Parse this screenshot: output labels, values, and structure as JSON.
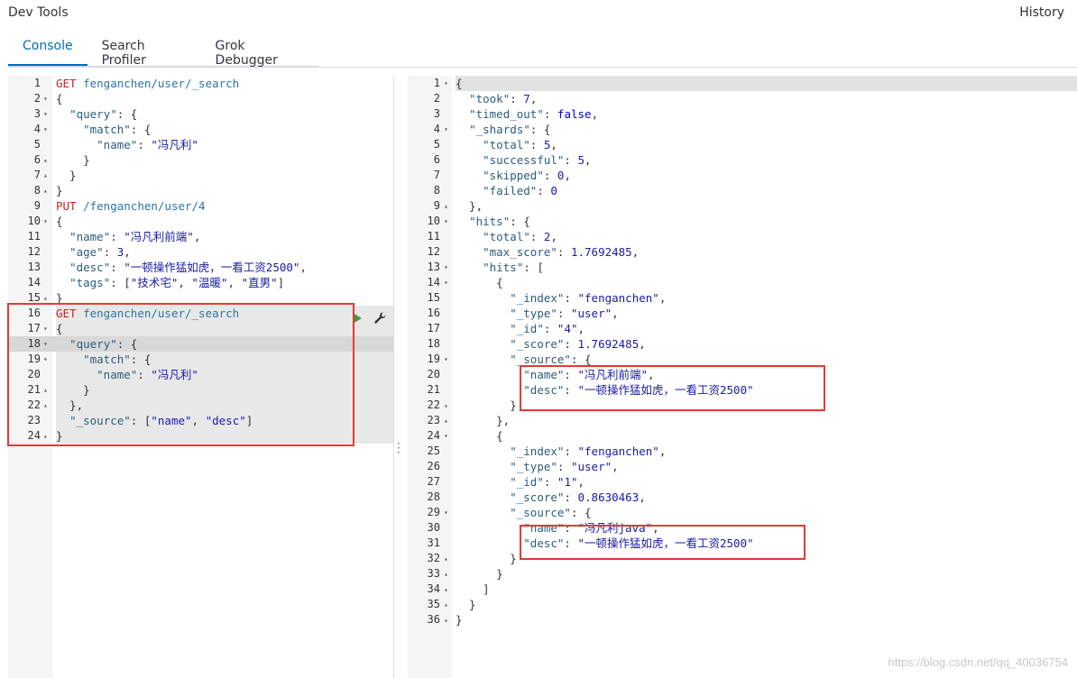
{
  "app": {
    "title": "Dev Tools",
    "history": "History"
  },
  "tabs": [
    {
      "label": "Console"
    },
    {
      "label": "Search Profiler"
    },
    {
      "label": "Grok Debugger"
    }
  ],
  "left_lines": [
    {
      "n": "1",
      "f": "",
      "html": "<span class='m'>GET</span> <span class='u'>fenganchen/user/_search</span>"
    },
    {
      "n": "2",
      "f": "▾",
      "html": "{"
    },
    {
      "n": "3",
      "f": "▾",
      "html": "  <span class='k'>\"query\"</span>: {"
    },
    {
      "n": "4",
      "f": "▾",
      "html": "    <span class='k'>\"match\"</span>: {"
    },
    {
      "n": "5",
      "f": "",
      "html": "      <span class='k'>\"name\"</span>: <span class='s'>\"冯凡利\"</span>"
    },
    {
      "n": "6",
      "f": "▴",
      "html": "    }"
    },
    {
      "n": "7",
      "f": "▴",
      "html": "  }"
    },
    {
      "n": "8",
      "f": "▴",
      "html": "}"
    },
    {
      "n": "9",
      "f": "",
      "html": "<span class='m'>PUT</span> <span class='u'>/fenganchen/user/4</span>"
    },
    {
      "n": "10",
      "f": "▾",
      "html": "{"
    },
    {
      "n": "11",
      "f": "",
      "html": "  <span class='k'>\"name\"</span>: <span class='s'>\"冯凡利前端\"</span>,"
    },
    {
      "n": "12",
      "f": "",
      "html": "  <span class='k'>\"age\"</span>: <span class='n'>3</span>,"
    },
    {
      "n": "13",
      "f": "",
      "html": "  <span class='k'>\"desc\"</span>: <span class='s'>\"一顿操作猛如虎，一看工资2500\"</span>,"
    },
    {
      "n": "14",
      "f": "",
      "html": "  <span class='k'>\"tags\"</span>: [<span class='s'>\"技术宅\"</span>, <span class='s'>\"温暖\"</span>, <span class='s'>\"直男\"</span>]"
    },
    {
      "n": "15",
      "f": "▴",
      "html": "}"
    },
    {
      "n": "16",
      "f": "",
      "html": "<span class='m'>GET</span> <span class='u'>fenganchen/user/_search</span>"
    },
    {
      "n": "17",
      "f": "▾",
      "html": "{"
    },
    {
      "n": "18",
      "f": "▾",
      "html": "  <span class='k'>\"query\"</span>: {"
    },
    {
      "n": "19",
      "f": "▾",
      "html": "    <span class='k'>\"match\"</span>: {"
    },
    {
      "n": "20",
      "f": "",
      "html": "      <span class='k'>\"name\"</span>: <span class='s'>\"冯凡利\"</span>"
    },
    {
      "n": "21",
      "f": "▴",
      "html": "    }"
    },
    {
      "n": "22",
      "f": "▴",
      "html": "  },"
    },
    {
      "n": "23",
      "f": "",
      "html": "  <span class='k'>\"_source\"</span>: [<span class='s'>\"name\"</span>, <span class='s'>\"desc\"</span>]"
    },
    {
      "n": "24",
      "f": "▴",
      "html": "}"
    }
  ],
  "right_lines": [
    {
      "n": "1",
      "f": "▾",
      "html": "{"
    },
    {
      "n": "2",
      "f": "",
      "html": "  <span class='k'>\"took\"</span>: <span class='n'>7</span>,"
    },
    {
      "n": "3",
      "f": "",
      "html": "  <span class='k'>\"timed_out\"</span>: <span class='kw'>false</span>,"
    },
    {
      "n": "4",
      "f": "▾",
      "html": "  <span class='k'>\"_shards\"</span>: {"
    },
    {
      "n": "5",
      "f": "",
      "html": "    <span class='k'>\"total\"</span>: <span class='n'>5</span>,"
    },
    {
      "n": "6",
      "f": "",
      "html": "    <span class='k'>\"successful\"</span>: <span class='n'>5</span>,"
    },
    {
      "n": "7",
      "f": "",
      "html": "    <span class='k'>\"skipped\"</span>: <span class='n'>0</span>,"
    },
    {
      "n": "8",
      "f": "",
      "html": "    <span class='k'>\"failed\"</span>: <span class='n'>0</span>"
    },
    {
      "n": "9",
      "f": "▴",
      "html": "  },"
    },
    {
      "n": "10",
      "f": "▾",
      "html": "  <span class='k'>\"hits\"</span>: {"
    },
    {
      "n": "11",
      "f": "",
      "html": "    <span class='k'>\"total\"</span>: <span class='n'>2</span>,"
    },
    {
      "n": "12",
      "f": "",
      "html": "    <span class='k'>\"max_score\"</span>: <span class='n'>1.7692485</span>,"
    },
    {
      "n": "13",
      "f": "▾",
      "html": "    <span class='k'>\"hits\"</span>: ["
    },
    {
      "n": "14",
      "f": "▾",
      "html": "      {"
    },
    {
      "n": "15",
      "f": "",
      "html": "        <span class='k'>\"_index\"</span>: <span class='s'>\"fenganchen\"</span>,"
    },
    {
      "n": "16",
      "f": "",
      "html": "        <span class='k'>\"_type\"</span>: <span class='s'>\"user\"</span>,"
    },
    {
      "n": "17",
      "f": "",
      "html": "        <span class='k'>\"_id\"</span>: <span class='s'>\"4\"</span>,"
    },
    {
      "n": "18",
      "f": "",
      "html": "        <span class='k'>\"_score\"</span>: <span class='n'>1.7692485</span>,"
    },
    {
      "n": "19",
      "f": "▾",
      "html": "        <span class='k'>\"_source\"</span>: {"
    },
    {
      "n": "20",
      "f": "",
      "html": "          <span class='k'>\"name\"</span>: <span class='s'>\"冯凡利前端\"</span>,"
    },
    {
      "n": "21",
      "f": "",
      "html": "          <span class='k'>\"desc\"</span>: <span class='s'>\"一顿操作猛如虎，一看工资2500\"</span>"
    },
    {
      "n": "22",
      "f": "▴",
      "html": "        }"
    },
    {
      "n": "23",
      "f": "▴",
      "html": "      },"
    },
    {
      "n": "24",
      "f": "▾",
      "html": "      {"
    },
    {
      "n": "25",
      "f": "",
      "html": "        <span class='k'>\"_index\"</span>: <span class='s'>\"fenganchen\"</span>,"
    },
    {
      "n": "26",
      "f": "",
      "html": "        <span class='k'>\"_type\"</span>: <span class='s'>\"user\"</span>,"
    },
    {
      "n": "27",
      "f": "",
      "html": "        <span class='k'>\"_id\"</span>: <span class='s'>\"1\"</span>,"
    },
    {
      "n": "28",
      "f": "",
      "html": "        <span class='k'>\"_score\"</span>: <span class='n'>0.8630463</span>,"
    },
    {
      "n": "29",
      "f": "▾",
      "html": "        <span class='k'>\"_source\"</span>: {"
    },
    {
      "n": "30",
      "f": "",
      "html": "          <span class='k'>\"name\"</span>: <span class='s'>\"冯凡利java\"</span>,"
    },
    {
      "n": "31",
      "f": "",
      "html": "          <span class='k'>\"desc\"</span>: <span class='s'>\"一顿操作猛如虎，一看工资2500\"</span>"
    },
    {
      "n": "32",
      "f": "▴",
      "html": "        }"
    },
    {
      "n": "33",
      "f": "▴",
      "html": "      }"
    },
    {
      "n": "34",
      "f": "▴",
      "html": "    ]"
    },
    {
      "n": "35",
      "f": "▴",
      "html": "  }"
    },
    {
      "n": "36",
      "f": "▴",
      "html": "}"
    }
  ],
  "watermark": "https://blog.csdn.net/qq_40036754"
}
